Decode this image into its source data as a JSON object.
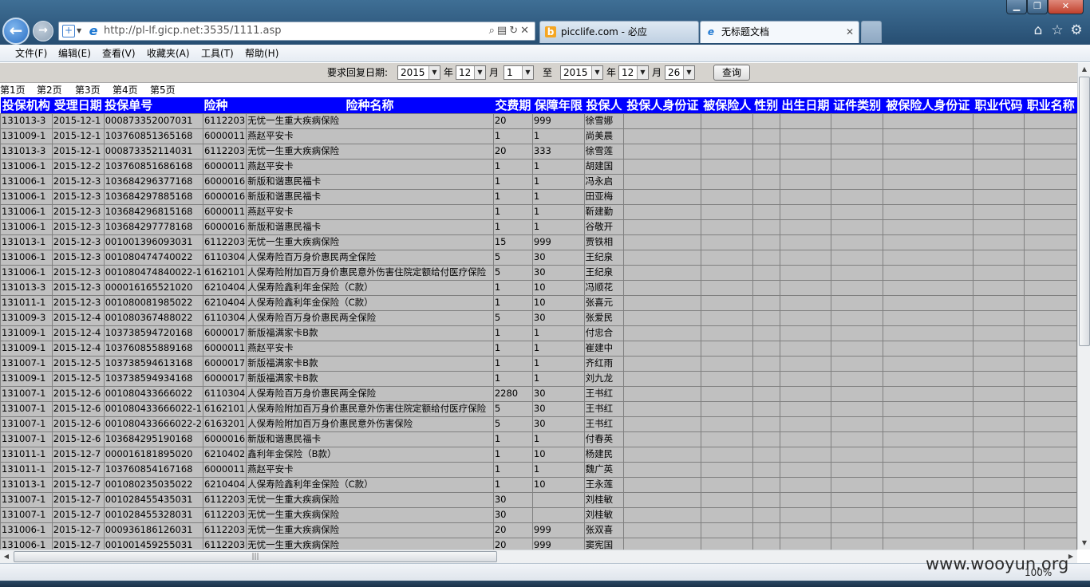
{
  "browser": {
    "url": "http://pl-lf.gicp.net:3535/1111.asp",
    "tabs": [
      {
        "label": "picclife.com - 必应",
        "close": "✕"
      },
      {
        "label": "无标题文档",
        "close": "✕"
      }
    ],
    "window_buttons": {
      "minimize": "▁",
      "maximize": "❐",
      "close": "✕"
    }
  },
  "menu": [
    "文件(F)",
    "编辑(E)",
    "查看(V)",
    "收藏夹(A)",
    "工具(T)",
    "帮助(H)"
  ],
  "query": {
    "label": "要求回复日期:",
    "from_year": "2015",
    "year_unit": "年",
    "from_month": "12",
    "month_unit": "月",
    "from_day": "1",
    "to": "至",
    "to_year": "2015",
    "to_month": "12",
    "to_day": "26",
    "button": "查询"
  },
  "pages": [
    "第1页",
    "第2页",
    "第3页",
    "第4页",
    "第5页"
  ],
  "table": {
    "headers": [
      "投保机构",
      "受理日期",
      "投保单号",
      "险种",
      "险种名称",
      "交费期",
      "保障年限",
      "投保人",
      "投保人身份证",
      "被保险人",
      "性别",
      "出生日期",
      "证件类别",
      "被保险人身份证",
      "职业代码",
      "职业名称"
    ],
    "rows": [
      [
        "131013-3",
        "2015-12-1",
        "000873352007031",
        "6112203",
        "无忧一生重大疾病保险",
        "20",
        "999",
        "徐雪娜"
      ],
      [
        "131009-1",
        "2015-12-1",
        "103760851365168",
        "6000011",
        "燕赵平安卡",
        "1",
        "1",
        "尚美晨"
      ],
      [
        "131013-3",
        "2015-12-1",
        "000873352114031",
        "6112203",
        "无忧一生重大疾病保险",
        "20",
        "333",
        "徐雪莲"
      ],
      [
        "131006-1",
        "2015-12-2",
        "103760851686168",
        "6000011",
        "燕赵平安卡",
        "1",
        "1",
        "胡建国"
      ],
      [
        "131006-1",
        "2015-12-3",
        "103684296377168",
        "6000016",
        "新版和谐惠民福卡",
        "1",
        "1",
        "冯永启"
      ],
      [
        "131006-1",
        "2015-12-3",
        "103684297885168",
        "6000016",
        "新版和谐惠民福卡",
        "1",
        "1",
        "田亚梅"
      ],
      [
        "131006-1",
        "2015-12-3",
        "103684296815168",
        "6000011",
        "燕赵平安卡",
        "1",
        "1",
        "靳建勤"
      ],
      [
        "131006-1",
        "2015-12-3",
        "103684297778168",
        "6000016",
        "新版和谐惠民福卡",
        "1",
        "1",
        "谷敬开"
      ],
      [
        "131013-1",
        "2015-12-3",
        "001001396093031",
        "6112203",
        "无忧一生重大疾病保险",
        "15",
        "999",
        "贾铁相"
      ],
      [
        "131006-1",
        "2015-12-3",
        "001080474740022",
        "6110304",
        "人保寿险百万身价惠民两全保险",
        "5",
        "30",
        "王纪泉"
      ],
      [
        "131006-1",
        "2015-12-3",
        "001080474840022-1",
        "6162101",
        "人保寿险附加百万身价惠民意外伤害住院定额给付医疗保险",
        "5",
        "30",
        "王纪泉"
      ],
      [
        "131013-3",
        "2015-12-3",
        "000016165521020",
        "6210404",
        "人保寿险鑫利年金保险（C款）",
        "1",
        "10",
        "冯顺花"
      ],
      [
        "131011-1",
        "2015-12-3",
        "001080081985022",
        "6210404",
        "人保寿险鑫利年金保险（C款）",
        "1",
        "10",
        "张喜元"
      ],
      [
        "131009-3",
        "2015-12-4",
        "001080367488022",
        "6110304",
        "人保寿险百万身价惠民两全保险",
        "5",
        "30",
        "张爱民"
      ],
      [
        "131009-1",
        "2015-12-4",
        "103738594720168",
        "6000017",
        "新版福满家卡B款",
        "1",
        "1",
        "付忠合"
      ],
      [
        "131009-1",
        "2015-12-4",
        "103760855889168",
        "6000011",
        "燕赵平安卡",
        "1",
        "1",
        "崔建中"
      ],
      [
        "131007-1",
        "2015-12-5",
        "103738594613168",
        "6000017",
        "新版福满家卡B款",
        "1",
        "1",
        "齐红雨"
      ],
      [
        "131009-1",
        "2015-12-5",
        "103738594934168",
        "6000017",
        "新版福满家卡B款",
        "1",
        "1",
        "刘九龙"
      ],
      [
        "131007-1",
        "2015-12-6",
        "001080433666022",
        "6110304",
        "人保寿险百万身价惠民两全保险",
        "2280",
        "30",
        "王书红"
      ],
      [
        "131007-1",
        "2015-12-6",
        "001080433666022-1",
        "6162101",
        "人保寿险附加百万身价惠民意外伤害住院定额给付医疗保险",
        "5",
        "30",
        "王书红"
      ],
      [
        "131007-1",
        "2015-12-6",
        "001080433666022-2",
        "6163201",
        "人保寿险附加百万身价惠民意外伤害保险",
        "5",
        "30",
        "王书红"
      ],
      [
        "131007-1",
        "2015-12-6",
        "103684295190168",
        "6000016",
        "新版和谐惠民福卡",
        "1",
        "1",
        "付春英"
      ],
      [
        "131011-1",
        "2015-12-7",
        "000016181895020",
        "6210402",
        "鑫利年金保险（B款）",
        "1",
        "10",
        "杨建民"
      ],
      [
        "131011-1",
        "2015-12-7",
        "103760854167168",
        "6000011",
        "燕赵平安卡",
        "1",
        "1",
        "魏广英"
      ],
      [
        "131013-1",
        "2015-12-7",
        "001080235035022",
        "6210404",
        "人保寿险鑫利年金保险（C款）",
        "1",
        "10",
        "王永莲"
      ],
      [
        "131007-1",
        "2015-12-7",
        "001028455435031",
        "6112203",
        "无忧一生重大疾病保险",
        "30",
        "",
        "刘桂敏"
      ],
      [
        "131007-1",
        "2015-12-7",
        "001028455328031",
        "6112203",
        "无忧一生重大疾病保险",
        "30",
        "",
        "刘桂敏"
      ],
      [
        "131006-1",
        "2015-12-7",
        "000936186126031",
        "6112203",
        "无忧一生重大疾病保险",
        "20",
        "999",
        "张双喜"
      ],
      [
        "131006-1",
        "2015-12-7",
        "001001459255031",
        "6112203",
        "无忧一生重大疾病保险",
        "20",
        "999",
        "窦宪国"
      ]
    ]
  },
  "status": {
    "zoom": "100%"
  },
  "watermark": "www.wooyun.org",
  "colors": {
    "header_bg": "#0000ff",
    "header_text": "#ffffff",
    "cell_bg": "#c0c0c0",
    "form_bg": "#d6d3ce"
  }
}
